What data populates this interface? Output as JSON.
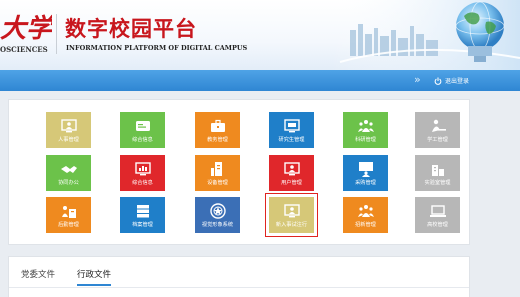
{
  "header": {
    "university_chars": "大学",
    "university_en": "OSCIENCES",
    "title_cn": "数字校园平台",
    "title_en": "INFORMATION PLATFORM OF DIGITAL CAMPUS"
  },
  "navbar": {
    "chevron": "»",
    "logout_label": "退出登录",
    "logout_icon": "power-icon"
  },
  "tiles": [
    {
      "label": "人事管理",
      "color": "#d6c878",
      "icon": "monitor-person-icon"
    },
    {
      "label": "综合信息",
      "color": "#6cc24a",
      "icon": "id-card-icon"
    },
    {
      "label": "教务管理",
      "color": "#ef8a1f",
      "icon": "briefcase-icon"
    },
    {
      "label": "研究生管理",
      "color": "#1f7fc9",
      "icon": "monitor-id-icon"
    },
    {
      "label": "科研管理",
      "color": "#6cc24a",
      "icon": "people-group-icon"
    },
    {
      "label": "学工管理",
      "color": "#b7b7b7",
      "icon": "person-desk-icon"
    },
    {
      "label": "协同办公",
      "color": "#6cc24a",
      "icon": "handshake-icon"
    },
    {
      "label": "综合信息",
      "color": "#e0272b",
      "icon": "chart-monitor-icon"
    },
    {
      "label": "设备管理",
      "color": "#ef8a1f",
      "icon": "device-cabinet-icon"
    },
    {
      "label": "用户管理",
      "color": "#e0272b",
      "icon": "user-monitor-icon"
    },
    {
      "label": "采购管理",
      "color": "#1f7fc9",
      "icon": "presenter-icon"
    },
    {
      "label": "实验室管理",
      "color": "#b7b7b7",
      "icon": "building-chart-icon"
    },
    {
      "label": "后勤管理",
      "color": "#ef8a1f",
      "icon": "logistics-icon"
    },
    {
      "label": "档案管理",
      "color": "#1f7fc9",
      "icon": "archive-stack-icon"
    },
    {
      "label": "视觉形象系统",
      "color": "#3b6fb6",
      "icon": "emblem-icon"
    },
    {
      "label": "新入事试注行",
      "color": "#d6c878",
      "icon": "monitor-person-icon"
    },
    {
      "label": "招新管理",
      "color": "#ef8a1f",
      "icon": "people-group-icon"
    },
    {
      "label": "高校管理",
      "color": "#b7b7b7",
      "icon": "laptop-icon"
    }
  ],
  "tabs": [
    {
      "label": "党委文件",
      "active": false
    },
    {
      "label": "行政文件",
      "active": true
    }
  ]
}
